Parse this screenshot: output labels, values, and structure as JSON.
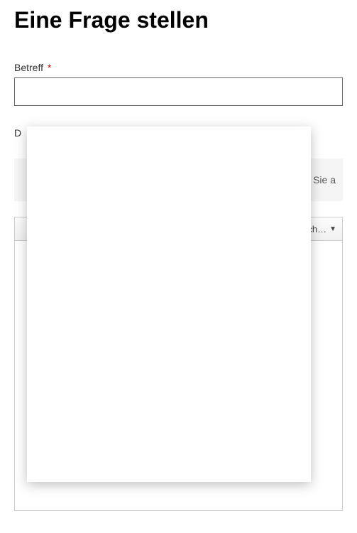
{
  "page": {
    "title": "Eine Frage stellen"
  },
  "form": {
    "subject": {
      "label": "Betreff",
      "required": "*",
      "value": ""
    },
    "secondField": {
      "labelPartial": "D"
    },
    "attachment": {
      "hintPartial": "hen Sie a"
    },
    "toolbar": {
      "dropdownLabel": "sch…",
      "caret": "▼"
    }
  }
}
